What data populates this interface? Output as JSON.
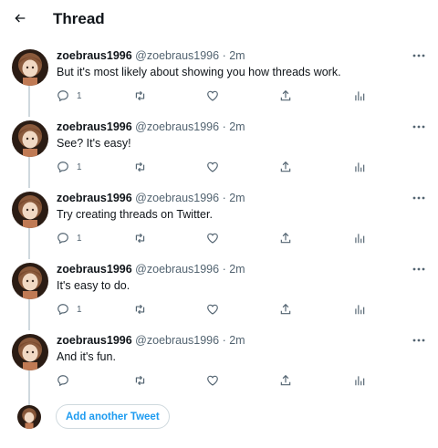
{
  "header": {
    "title": "Thread",
    "back_icon": "arrow-left-icon"
  },
  "tweets": [
    {
      "name": "zoebraus1996",
      "handle": "@zoebraus1996",
      "dot": "·",
      "time": "2m",
      "text": "But it's most likely about showing you how threads work.",
      "reply_count": "1"
    },
    {
      "name": "zoebraus1996",
      "handle": "@zoebraus1996",
      "dot": "·",
      "time": "2m",
      "text": "See? It's easy!",
      "reply_count": "1"
    },
    {
      "name": "zoebraus1996",
      "handle": "@zoebraus1996",
      "dot": "·",
      "time": "2m",
      "text": "Try creating threads on Twitter.",
      "reply_count": "1"
    },
    {
      "name": "zoebraus1996",
      "handle": "@zoebraus1996",
      "dot": "·",
      "time": "2m",
      "text": "It's easy to do.",
      "reply_count": "1"
    },
    {
      "name": "zoebraus1996",
      "handle": "@zoebraus1996",
      "dot": "·",
      "time": "2m",
      "text": "And it's fun.",
      "reply_count": ""
    }
  ],
  "add_tweet": {
    "label": "Add another Tweet"
  },
  "colors": {
    "accent": "#1d9bf0",
    "secondary_text": "#536471",
    "border": "#cfd9de"
  },
  "icons": [
    "arrow-left-icon",
    "more-icon",
    "reply-icon",
    "retweet-icon",
    "like-icon",
    "share-icon",
    "analytics-icon"
  ]
}
